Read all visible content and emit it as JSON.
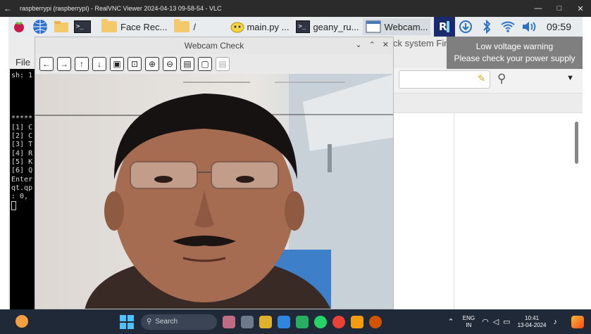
{
  "vnc_window": {
    "title": "raspberrypi (raspberrypi) - RealVNC Viewer 2024-04-13 09-58-54 - VLC",
    "controls": [
      "—",
      "□",
      "✕"
    ]
  },
  "pi_panel": {
    "tasks": [
      {
        "label": "Face Rec...",
        "icon": "folder-icon"
      },
      {
        "label": "/",
        "icon": "folder-icon"
      },
      {
        "label": "main.py ...",
        "icon": "geany-icon"
      },
      {
        "label": "geany_ru...",
        "icon": "terminal-icon"
      },
      {
        "label": "Webcam...",
        "icon": "window-icon"
      }
    ],
    "clock": "09:59"
  },
  "warning": {
    "title": "Low voltage warning",
    "message": "Please check your power supply"
  },
  "background_app": {
    "file_menu": "File",
    "geany_title_fragment": "ck system Fin"
  },
  "terminal": {
    "lines": [
      "sh: 1",
      "",
      "",
      "",
      "",
      "*****",
      "[1] C",
      "[2] C",
      "[3] T",
      "[4] R",
      "[5] K",
      "[6] Q",
      "Enter",
      "qt.qp",
      ": 0,"
    ]
  },
  "webcam_window": {
    "title": "Webcam Check",
    "tools": [
      "back-icon",
      "forward-icon",
      "up-icon",
      "down-icon",
      "fit-image-icon",
      "fit-window-icon",
      "zoom-in-icon",
      "zoom-out-icon",
      "save-icon",
      "copy-icon",
      "save-disabled-icon"
    ]
  },
  "windows_taskbar": {
    "search_placeholder": "Search",
    "language_line1": "ENG",
    "language_line2": "IN",
    "time": "10:41",
    "date": "13-04-2024"
  }
}
